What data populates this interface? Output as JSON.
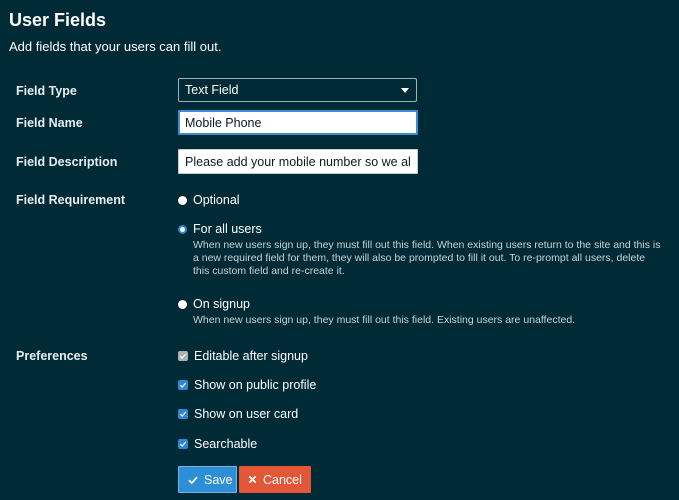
{
  "header": {
    "title": "User Fields",
    "subtitle": "Add fields that your users can fill out."
  },
  "form": {
    "field_type": {
      "label": "Field Type",
      "selected": "Text Field"
    },
    "field_name": {
      "label": "Field Name",
      "value": "Mobile Phone"
    },
    "field_description": {
      "label": "Field Description",
      "value": "Please add your mobile number so we all know"
    },
    "field_requirement": {
      "label": "Field Requirement",
      "options": [
        {
          "label": "Optional",
          "description": ""
        },
        {
          "label": "For all users",
          "description": "When new users sign up, they must fill out this field. When existing users return to the site and this is a new required field for them, they will also be prompted to fill it out. To re-prompt all users, delete this custom field and re-create it."
        },
        {
          "label": "On signup",
          "description": "When new users sign up, they must fill out this field. Existing users are unaffected."
        }
      ],
      "selected": "For all users"
    },
    "preferences": {
      "label": "Preferences",
      "items": [
        {
          "label": "Editable after signup",
          "checked": true,
          "disabled": true
        },
        {
          "label": "Show on public profile",
          "checked": true,
          "disabled": false
        },
        {
          "label": "Show on user card",
          "checked": true,
          "disabled": false
        },
        {
          "label": "Searchable",
          "checked": true,
          "disabled": false
        }
      ]
    }
  },
  "actions": {
    "save_label": "Save",
    "cancel_label": "Cancel"
  },
  "colors": {
    "background": "#002b36",
    "primary": "#2e8fd7",
    "danger": "#e45638"
  }
}
